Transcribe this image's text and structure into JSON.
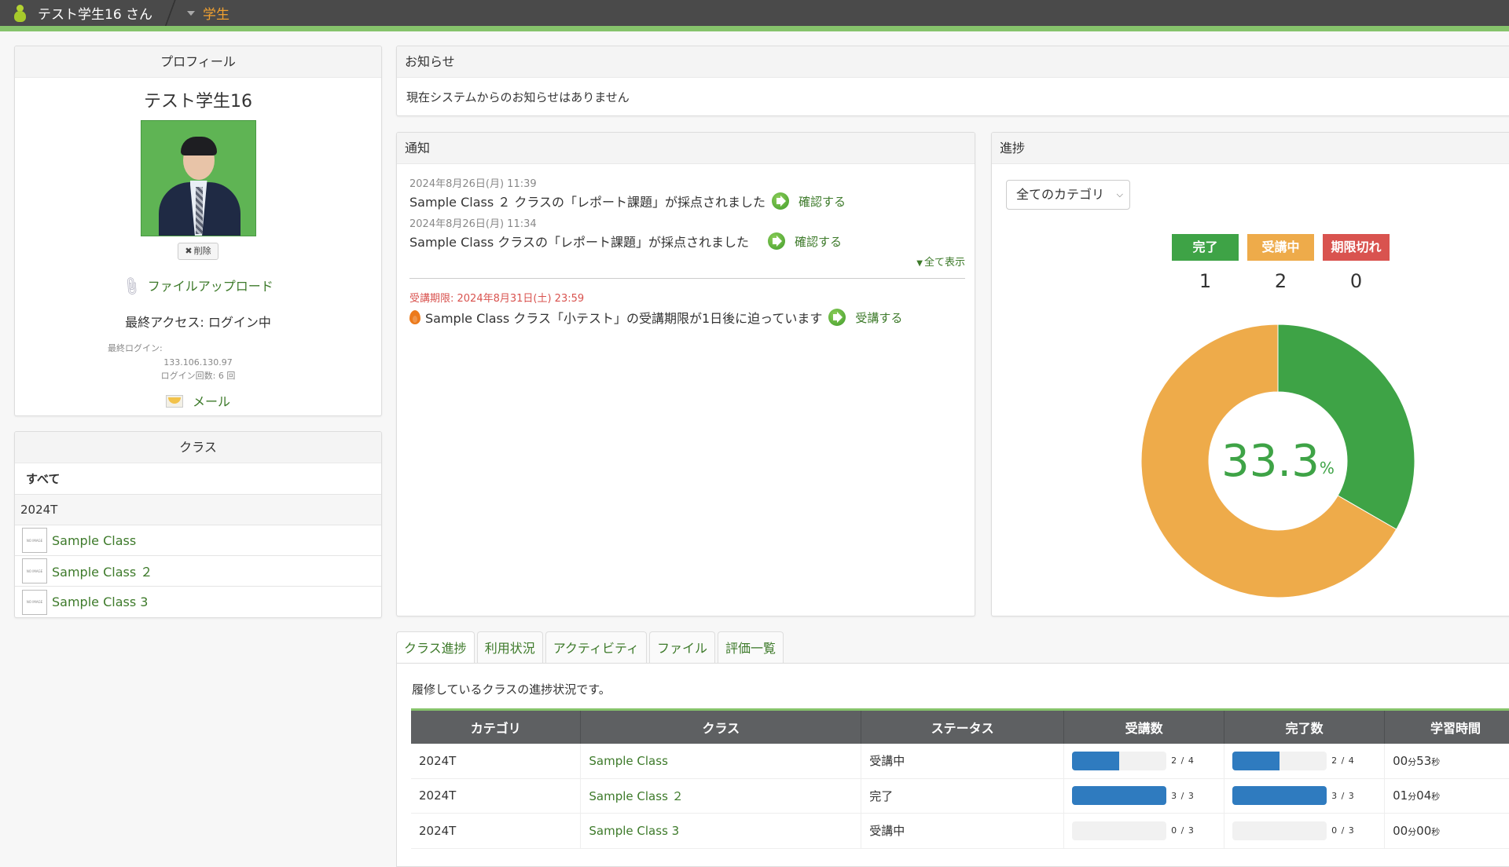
{
  "topbar": {
    "user_name": "テスト学生16 さん",
    "role": "学生"
  },
  "profile": {
    "title": "プロフィール",
    "name": "テスト学生16",
    "delete_label": "削除",
    "upload_label": "ファイルアップロード",
    "last_access": "最終アクセス: ログイン中",
    "last_login_label": "最終ログイン:",
    "last_login_ip": "133.106.130.97",
    "login_count": "ログイン回数: 6 回",
    "mail_label": "メール"
  },
  "classes": {
    "title": "クラス",
    "all_label": "すべて",
    "category": "2024T",
    "no_image_text": "NO IMAGE",
    "items": [
      {
        "name": "Sample Class"
      },
      {
        "name": "Sample Class ２"
      },
      {
        "name": "Sample Class 3"
      }
    ]
  },
  "notice": {
    "title": "お知らせ",
    "body": "現在システムからのお知らせはありません"
  },
  "notifications": {
    "title": "通知",
    "items": [
      {
        "date": "2024年8月26日(月) 11:39",
        "text": "Sample Class ２ クラスの「レポート課題」が採点されました",
        "link": "確認する"
      },
      {
        "date": "2024年8月26日(月) 11:34",
        "text": "Sample Class クラスの「レポート課題」が採点されました",
        "link": "確認する"
      }
    ],
    "show_all": "全て表示",
    "deadline": {
      "date": "受講期限: 2024年8月31日(土) 23:59",
      "text": "Sample Class クラス「小テスト」の受講期限が1日後に迫っています",
      "link": "受講する"
    }
  },
  "progress": {
    "title": "進捗",
    "category_select": "全てのカテゴリ",
    "legend": [
      {
        "label": "完了",
        "count": "1",
        "color": "#3ea346"
      },
      {
        "label": "受講中",
        "count": "2",
        "color": "#eeab4a"
      },
      {
        "label": "期限切れ",
        "count": "0",
        "color": "#d9534f"
      }
    ],
    "center_value": "33.3",
    "center_unit": "%"
  },
  "chart_data": {
    "type": "pie",
    "title": "進捗",
    "categories": [
      "完了",
      "受講中",
      "期限切れ"
    ],
    "values": [
      1,
      2,
      0
    ],
    "colors": [
      "#3ea346",
      "#eeab4a",
      "#d9534f"
    ],
    "center_label": "33.3%",
    "donut": true
  },
  "tabs": [
    {
      "label": "クラス進捗",
      "active": true
    },
    {
      "label": "利用状況"
    },
    {
      "label": "アクティビティ"
    },
    {
      "label": "ファイル"
    },
    {
      "label": "評価一覧"
    }
  ],
  "class_progress": {
    "description": "履修しているクラスの進捗状況です。",
    "columns": [
      "カテゴリ",
      "クラス",
      "ステータス",
      "受講数",
      "完了数",
      "学習時間"
    ],
    "rows": [
      {
        "category": "2024T",
        "class": "Sample Class",
        "status": "受講中",
        "attend": "2 / 4",
        "attend_ratio": 0.5,
        "done": "2 / 4",
        "done_ratio": 0.5,
        "time_min": "00",
        "time_sec": "53"
      },
      {
        "category": "2024T",
        "class": "Sample Class ２",
        "status": "完了",
        "attend": "3 / 3",
        "attend_ratio": 1.0,
        "done": "3 / 3",
        "done_ratio": 1.0,
        "time_min": "01",
        "time_sec": "04"
      },
      {
        "category": "2024T",
        "class": "Sample Class 3",
        "status": "受講中",
        "attend": "0 / 3",
        "attend_ratio": 0.0,
        "done": "0 / 3",
        "done_ratio": 0.0,
        "time_min": "00",
        "time_sec": "00"
      }
    ],
    "min_unit": "分",
    "sec_unit": "秒"
  }
}
